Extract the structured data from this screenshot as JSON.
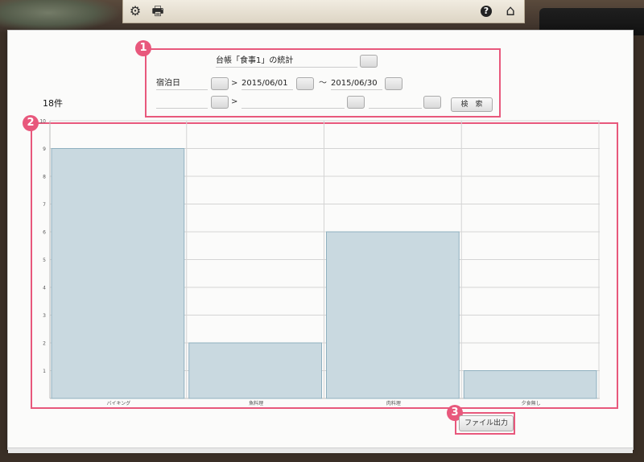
{
  "toolbar": {
    "icons": [
      "gear-icon",
      "printer-icon",
      "help-icon",
      "home-icon"
    ],
    "gear": "⚙",
    "print": "🖶",
    "help": "?",
    "home": "⌂"
  },
  "callouts": {
    "one": "1",
    "two": "2",
    "three": "3"
  },
  "filter": {
    "title": "台帳「食事1」の統計",
    "date_field_label": "宿泊日",
    "gt": ">",
    "tilde": "～",
    "date_from": "2015/06/01",
    "date_to": "2015/06/30",
    "search_label": "検　索"
  },
  "count_label": "18件",
  "colors": {
    "accent": "#e8587c",
    "bar_fill": "#c9d9e0",
    "bar_stroke": "#8fb0bf"
  },
  "chart_data": {
    "type": "bar",
    "categories": [
      "バイキング",
      "魚料理",
      "肉料理",
      "夕食無し"
    ],
    "values": [
      9,
      2,
      6,
      1
    ],
    "ylim": [
      0,
      10
    ],
    "yticks": [
      "1",
      "2",
      "3",
      "4",
      "5",
      "6",
      "7",
      "8",
      "9",
      "10"
    ],
    "grid": true
  },
  "export": {
    "label": "ファイル出力"
  }
}
